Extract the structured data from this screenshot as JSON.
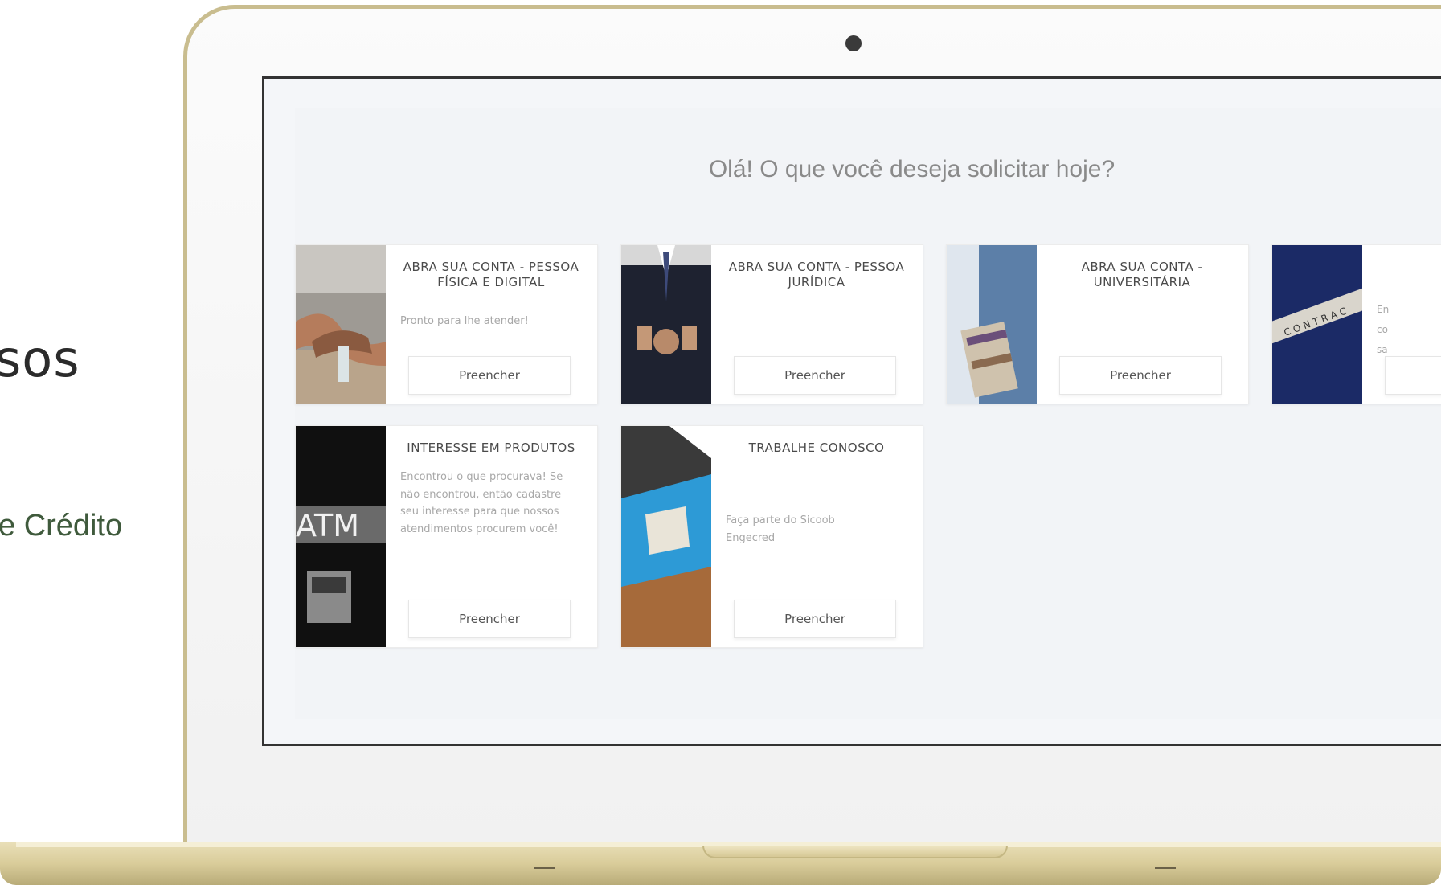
{
  "side": {
    "title_fragment": "sos",
    "subtitle_fragment": "e Crédito"
  },
  "screen": {
    "headline": "Olá! O que você deseja solicitar hoje?",
    "cards": [
      {
        "title": "ABRA SUA CONTA - PESSOA FÍSICA E DIGITAL",
        "description": "Pronto para lhe atender!",
        "button": "Preencher",
        "image": "handshake-photo"
      },
      {
        "title": "ABRA SUA CONTA - PESSOA JURÍDICA",
        "description": "",
        "button": "Preencher",
        "image": "businessman-suit-photo"
      },
      {
        "title": "ABRA SUA CONTA - UNIVERSITÁRIA",
        "description": "",
        "button": "Preencher",
        "image": "student-books-photo"
      },
      {
        "title": "",
        "description": "En co sa",
        "button": "",
        "image": "contract-letters-photo"
      },
      {
        "title": "INTERESSE EM PRODUTOS",
        "description": "Encontrou o que procurava! Se não encontrou, então cadastre seu interesse para que nossos atendimentos procurem você!",
        "button": "Preencher",
        "image": "atm-photo"
      },
      {
        "title": "TRABALHE CONOSCO",
        "description": "Faça parte do Sicoob Engecred",
        "button": "Preencher",
        "image": "puzzle-photo"
      }
    ]
  },
  "colors": {
    "frame_gold": "#c9bd8f",
    "side_subtitle_green": "#3f5a3c"
  }
}
